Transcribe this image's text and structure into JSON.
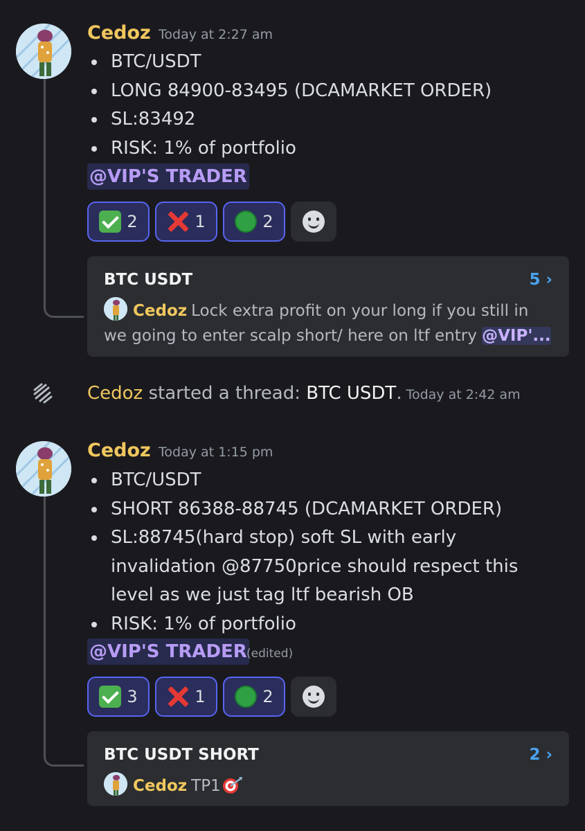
{
  "messages": [
    {
      "author": "Cedoz",
      "timestamp": "Today at 2:27 am",
      "bullets": [
        "BTC/USDT",
        "LONG 84900-83495 (DCAMARKET ORDER)",
        "SL:83492",
        "RISK: 1% of portfolio"
      ],
      "mention": "@VIP'S TRADER",
      "edited": "",
      "reactions": [
        {
          "icon": "check-mark-emoji",
          "count": "2"
        },
        {
          "icon": "cross-mark-emoji",
          "count": "1"
        },
        {
          "icon": "green-circle-emoji",
          "count": "2"
        }
      ],
      "thread": {
        "title": "BTC USDT",
        "count": "5 ›",
        "preview_author": "Cedoz",
        "preview_text": "Lock extra profit on your long if you still in we going to enter scalp short/ here on ltf entry",
        "preview_mention": "@VIP'..."
      }
    },
    {
      "author": "Cedoz",
      "timestamp": "Today at 1:15 pm",
      "bullets": [
        "BTC/USDT",
        "SHORT 86388-88745 (DCAMARKET ORDER)",
        "SL:88745(hard stop) soft SL with early invalidation @87750price should respect this level as we just tag ltf bearish OB",
        "RISK: 1% of portfolio"
      ],
      "mention": "@VIP'S TRADER",
      "edited": "(edited)",
      "reactions": [
        {
          "icon": "check-mark-emoji",
          "count": "3"
        },
        {
          "icon": "cross-mark-emoji",
          "count": "1"
        },
        {
          "icon": "green-circle-emoji",
          "count": "2"
        }
      ],
      "thread": {
        "title": "BTC USDT SHORT",
        "count": "2 ›",
        "preview_author": "Cedoz",
        "preview_text": "TP1",
        "preview_mention": ""
      }
    }
  ],
  "system": {
    "author": "Cedoz",
    "text": "started a thread:",
    "thread_name": "BTC USDT",
    "period": ".",
    "timestamp": "Today at 2:42 am"
  },
  "colors": {
    "author": "#f0c75e",
    "mention": "#c9b2ff",
    "thread_count": "#4aa3f0",
    "background": "#1a1a1e"
  }
}
